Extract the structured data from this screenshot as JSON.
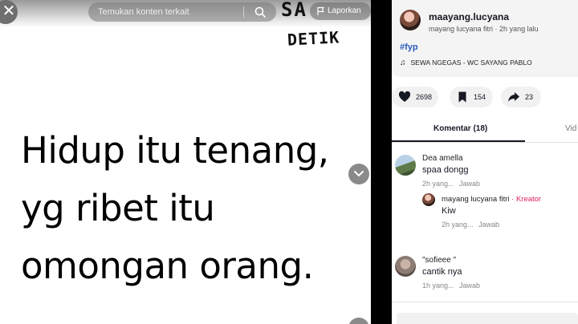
{
  "video": {
    "search_placeholder": "Temukan konten terkait",
    "report_label": "Laporkan",
    "brand_line1": "SA",
    "brand_line2": "DETIK",
    "quote_lines": [
      "Hidup itu tenang,",
      "yg ribet itu",
      "omongan orang."
    ]
  },
  "post": {
    "username": "maayang.lucyana",
    "display_name": "mayang lucyana fitri",
    "separator": " · ",
    "time": "2h yang lalu",
    "hashtag": "#fyp",
    "music": "SEWA NGEGAS - WC  SAYANG  PABLO"
  },
  "actions": {
    "likes": "2698",
    "saves": "154",
    "shares": "23"
  },
  "tabs": {
    "comments": "Komentar (18)",
    "videos": "Vid"
  },
  "comments": [
    {
      "name": "Dea amella",
      "text": "spaa dongg",
      "time": "2h yang...",
      "reply_label": "Jawab",
      "replies": [
        {
          "name": "mayang lucyana fitri",
          "separator": " · ",
          "badge": "Kreator",
          "text": "Kiw",
          "time": "2h yang...",
          "reply_label": "Jawab"
        }
      ]
    },
    {
      "name": "\"sofieee \"",
      "text": "cantik nya",
      "time": "1h yang...",
      "reply_label": "Jawab"
    }
  ],
  "colors": {
    "creator_badge": "#e0245e",
    "hashtag": "#2b5db9",
    "divider": "#000000"
  }
}
